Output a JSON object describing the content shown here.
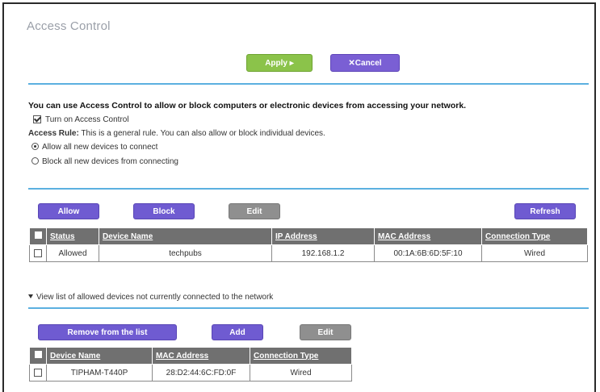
{
  "page": {
    "title": "Access Control",
    "apply_label": "Apply ▸",
    "cancel_label": "✕Cancel"
  },
  "intro": "You can use Access Control to allow or block computers or electronic devices from accessing your network.",
  "access_control": {
    "checkbox_label": "Turn on Access Control",
    "checked": true
  },
  "access_rule": {
    "heading": "Access Rule:",
    "description": "This is a general rule. You can also allow or block individual devices.",
    "options": [
      {
        "label": "Allow all new devices to connect",
        "selected": true
      },
      {
        "label": "Block all new devices from connecting",
        "selected": false
      }
    ]
  },
  "device_toolbar": {
    "allow_label": "Allow",
    "block_label": "Block",
    "edit_label": "Edit",
    "refresh_label": "Refresh"
  },
  "device_table": {
    "headers": [
      "Status",
      "Device Name",
      "IP Address",
      "MAC Address",
      "Connection Type"
    ],
    "rows": [
      {
        "status": "Allowed",
        "device_name": "techpubs",
        "ip": "192.168.1.2",
        "mac": "00:1A:6B:6D:5F:10",
        "connection": "Wired"
      }
    ]
  },
  "allowed_list": {
    "toggle_label": "View list of allowed devices not currently connected to the network",
    "remove_label": "Remove from the list",
    "add_label": "Add",
    "edit_label": "Edit",
    "headers": [
      "Device Name",
      "MAC Address",
      "Connection Type"
    ],
    "rows": [
      {
        "device_name": "TIPHAM-T440P",
        "mac": "28:D2:44:6C:FD:0F",
        "connection": "Wired"
      }
    ]
  },
  "colors": {
    "apply": "#8bc34a",
    "purple_button": "#6f5bd1",
    "gray_button": "#8f8f8f",
    "divider": "#5bb0e0",
    "allowed_status": "#3a9a2a"
  }
}
